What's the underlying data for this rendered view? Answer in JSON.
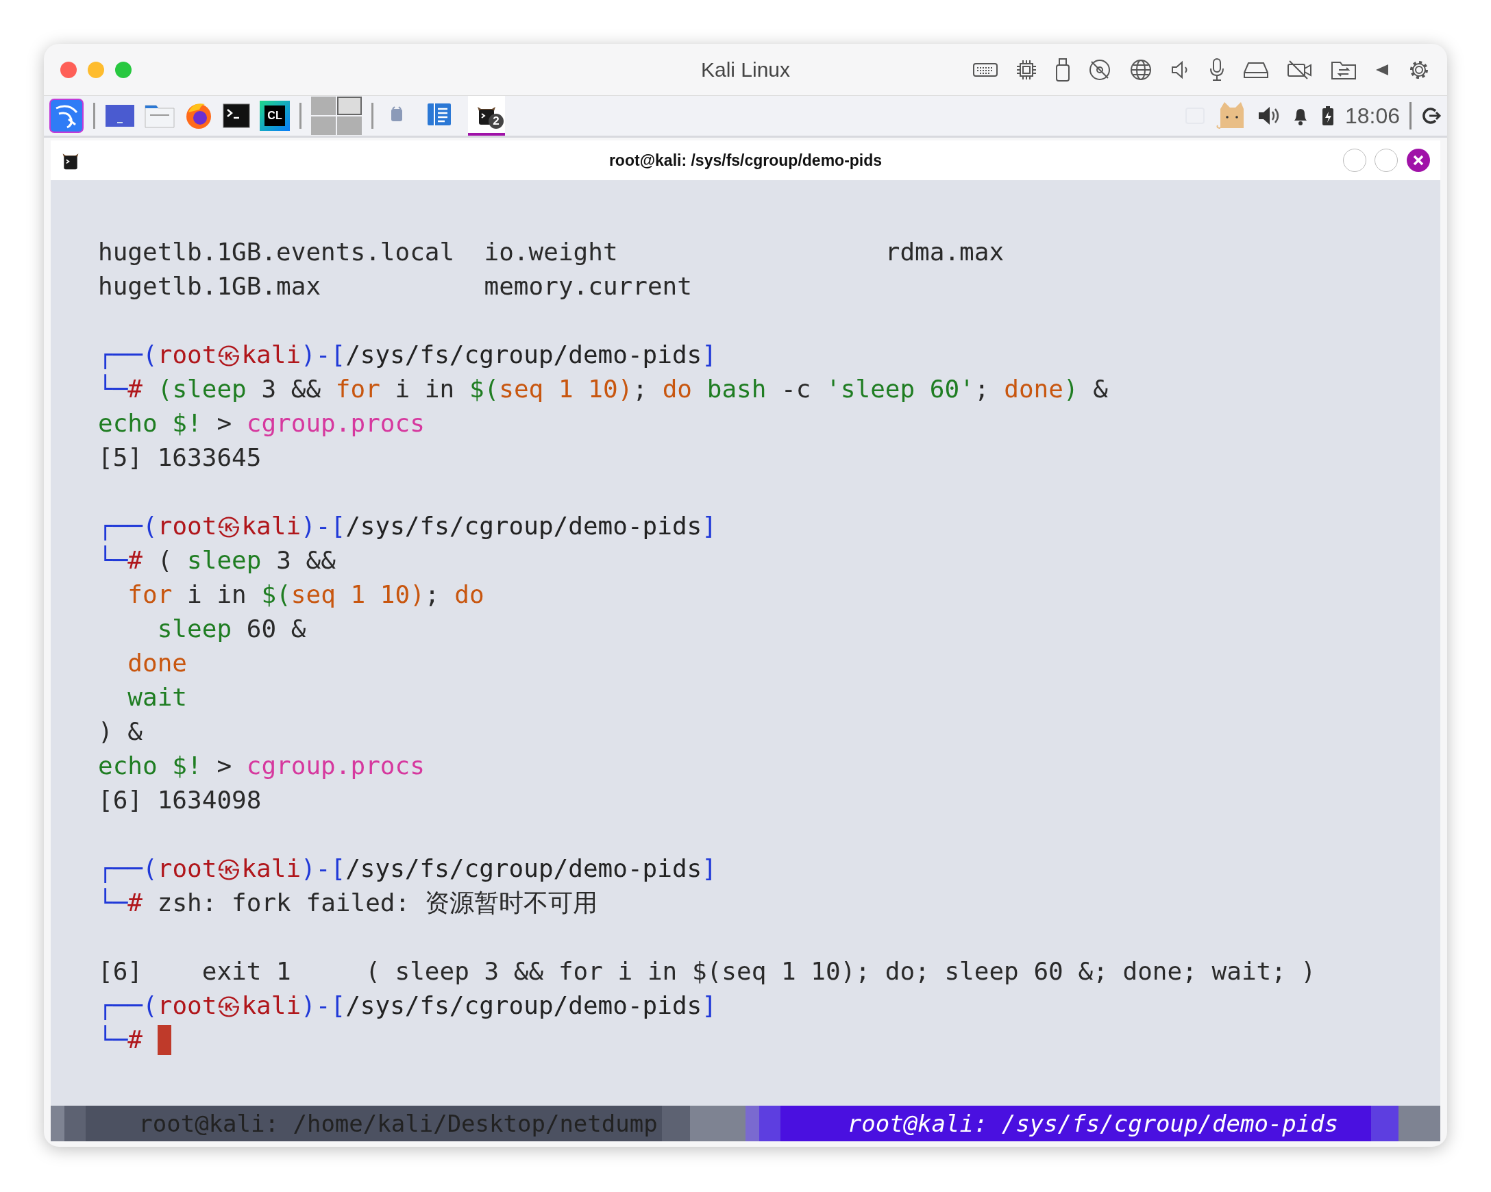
{
  "window": {
    "title": "Kali Linux"
  },
  "panel": {
    "launchers": [
      {
        "kind": "dragon"
      },
      {
        "kind": "desktop"
      },
      {
        "kind": "files"
      },
      {
        "kind": "browser"
      },
      {
        "kind": "terminal"
      },
      {
        "kind": "ide",
        "label": "CL"
      }
    ],
    "workspaces": [
      {
        "selected": false
      },
      {
        "selected": true
      },
      {
        "selected": false
      },
      {
        "selected": false
      }
    ],
    "windows": [
      {
        "kind": "app",
        "selected": false
      },
      {
        "kind": "notes",
        "selected": false
      },
      {
        "kind": "terminal",
        "selected": true,
        "badge": "2"
      }
    ],
    "clock": "18:06"
  },
  "terminal_window": {
    "title": "root@kali: /sys/fs/cgroup/demo-pids"
  },
  "terminal": {
    "lines": [
      {
        "kind": "listing",
        "cells": [
          "hugetlb.1GB.events.local",
          "io.weight",
          "rdma.max"
        ]
      },
      {
        "kind": "listing",
        "cells": [
          "hugetlb.1GB.max",
          "memory.current"
        ]
      },
      {
        "kind": "blank"
      },
      {
        "kind": "prompt",
        "segments": [
          {
            "t": "┌──(",
            "kind": "frame"
          },
          {
            "t": "root㉿kali",
            "kind": "user"
          },
          {
            "t": ")-[",
            "kind": "frame"
          },
          {
            "t": "/sys/fs/cgroup/demo-pids",
            "kind": "path"
          },
          {
            "t": "]",
            "kind": "frame"
          }
        ]
      },
      {
        "kind": "command",
        "cursor": false,
        "segments": [
          {
            "t": "└─",
            "kind": "frame"
          },
          {
            "t": "#",
            "kind": "user"
          },
          {
            "t": " (sleep",
            "kind": "cmd"
          },
          {
            "t": " 3 && ",
            "kind": "plain"
          },
          {
            "t": "for",
            "kind": "kw"
          },
          {
            "t": " i in ",
            "kind": "plain"
          },
          {
            "t": "$(",
            "kind": "cmd"
          },
          {
            "t": "seq 1 10)",
            "kind": "kw"
          },
          {
            "t": "; ",
            "kind": "plain"
          },
          {
            "t": "do",
            "kind": "kw"
          },
          {
            "t": " bash",
            "kind": "cmd"
          },
          {
            "t": " -c ",
            "kind": "plain"
          },
          {
            "t": "'sleep 60'",
            "kind": "cmd"
          },
          {
            "t": "; ",
            "kind": "plain"
          },
          {
            "t": "done",
            "kind": "kw"
          },
          {
            "t": ")",
            "kind": "cmd"
          },
          {
            "t": " &",
            "kind": "plain"
          }
        ]
      },
      {
        "kind": "text",
        "segments": [
          {
            "t": "echo $!",
            "kind": "cmd"
          },
          {
            "t": " > ",
            "kind": "plain"
          },
          {
            "t": "cgroup.procs",
            "kind": "file"
          }
        ]
      },
      {
        "kind": "text",
        "segments": [
          {
            "t": "[5] 1633645",
            "kind": "plain"
          }
        ]
      },
      {
        "kind": "blank"
      },
      {
        "kind": "prompt",
        "segments": [
          {
            "t": "┌──(",
            "kind": "frame"
          },
          {
            "t": "root㉿kali",
            "kind": "user"
          },
          {
            "t": ")-[",
            "kind": "frame"
          },
          {
            "t": "/sys/fs/cgroup/demo-pids",
            "kind": "path"
          },
          {
            "t": "]",
            "kind": "frame"
          }
        ]
      },
      {
        "kind": "command",
        "cursor": false,
        "segments": [
          {
            "t": "└─",
            "kind": "frame"
          },
          {
            "t": "#",
            "kind": "user"
          },
          {
            "t": " ( ",
            "kind": "plain"
          },
          {
            "t": "sleep",
            "kind": "cmd"
          },
          {
            "t": " 3 &&",
            "kind": "plain"
          }
        ]
      },
      {
        "kind": "text",
        "segments": [
          {
            "t": "  for",
            "kind": "kw"
          },
          {
            "t": " i in ",
            "kind": "plain"
          },
          {
            "t": "$(",
            "kind": "cmd"
          },
          {
            "t": "seq 1 10)",
            "kind": "kw"
          },
          {
            "t": "; ",
            "kind": "plain"
          },
          {
            "t": "do",
            "kind": "kw"
          }
        ]
      },
      {
        "kind": "text",
        "segments": [
          {
            "t": "    sleep",
            "kind": "cmd"
          },
          {
            "t": " 60 &",
            "kind": "plain"
          }
        ]
      },
      {
        "kind": "text",
        "segments": [
          {
            "t": "  done",
            "kind": "kw"
          }
        ]
      },
      {
        "kind": "text",
        "segments": [
          {
            "t": "  wait",
            "kind": "cmd"
          }
        ]
      },
      {
        "kind": "text",
        "segments": [
          {
            "t": ") &",
            "kind": "plain"
          }
        ]
      },
      {
        "kind": "text",
        "segments": [
          {
            "t": "echo $!",
            "kind": "cmd"
          },
          {
            "t": " > ",
            "kind": "plain"
          },
          {
            "t": "cgroup.procs",
            "kind": "file"
          }
        ]
      },
      {
        "kind": "text",
        "segments": [
          {
            "t": "[6] 1634098",
            "kind": "plain"
          }
        ]
      },
      {
        "kind": "blank"
      },
      {
        "kind": "prompt",
        "segments": [
          {
            "t": "┌──(",
            "kind": "frame"
          },
          {
            "t": "root㉿kali",
            "kind": "user"
          },
          {
            "t": ")-[",
            "kind": "frame"
          },
          {
            "t": "/sys/fs/cgroup/demo-pids",
            "kind": "path"
          },
          {
            "t": "]",
            "kind": "frame"
          }
        ]
      },
      {
        "kind": "command",
        "cursor": false,
        "segments": [
          {
            "t": "└─",
            "kind": "frame"
          },
          {
            "t": "#",
            "kind": "user"
          },
          {
            "t": " zsh: fork failed: 资源暂时不可用",
            "kind": "plain"
          }
        ]
      },
      {
        "kind": "blank"
      },
      {
        "kind": "job",
        "job": "[6]",
        "status": "exit 1",
        "command": "( sleep 3 && for i in $(seq 1 10); do; sleep 60 &; done; wait; )"
      },
      {
        "kind": "prompt",
        "segments": [
          {
            "t": "┌──(",
            "kind": "frame"
          },
          {
            "t": "root㉿kali",
            "kind": "user"
          },
          {
            "t": ")-[",
            "kind": "frame"
          },
          {
            "t": "/sys/fs/cgroup/demo-pids",
            "kind": "path"
          },
          {
            "t": "]",
            "kind": "frame"
          }
        ]
      },
      {
        "kind": "command",
        "cursor": true,
        "segments": [
          {
            "t": "└─",
            "kind": "frame"
          },
          {
            "t": "#",
            "kind": "user"
          }
        ]
      }
    ]
  },
  "tabs": [
    {
      "title": "root@kali: /home/kali/Desktop/netdump",
      "selected": false
    },
    {
      "title": "root@kali: /sys/fs/cgroup/demo-pids",
      "selected": true
    }
  ]
}
